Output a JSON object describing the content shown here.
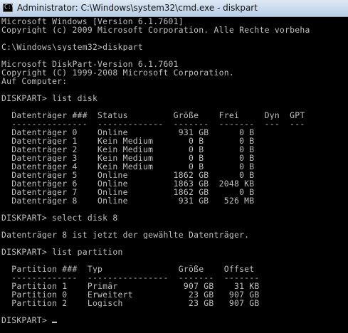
{
  "window": {
    "title": "Administrator: C:\\Windows\\system32\\cmd.exe - diskpart",
    "icon": "console-icon",
    "icon_glyph": "C:\\"
  },
  "console": {
    "lines": [
      "Microsoft Windows [Version 6.1.7601]",
      "Copyright (c) 2009 Microsoft Corporation. Alle Rechte vorbeha",
      "",
      "C:\\Windows\\system32>diskpart",
      "",
      "Microsoft DiskPart-Version 6.1.7601",
      "Copyright (C) 1999-2008 Microsoft Corporation.",
      "Auf Computer:",
      "",
      "DISKPART> list disk",
      "",
      "  Datenträger ###  Status         Größe    Frei     Dyn  GPT",
      "  ---------------  -------------  -------  -------  ---  ---",
      "  Datenträger 0    Online          931 GB      0 B",
      "  Datenträger 1    Kein Medium       0 B       0 B",
      "  Datenträger 2    Kein Medium       0 B       0 B",
      "  Datenträger 3    Kein Medium       0 B       0 B",
      "  Datenträger 4    Kein Medium       0 B       0 B",
      "  Datenträger 5    Online         1862 GB      0 B",
      "  Datenträger 6    Online         1863 GB  2048 KB",
      "  Datenträger 7    Online         1862 GB      0 B",
      "  Datenträger 8    Online          931 GB   526 MB",
      "",
      "DISKPART> select disk 8",
      "",
      "Datenträger 8 ist jetzt der gewählte Datenträger.",
      "",
      "DISKPART> list partition",
      "",
      "  Partition ###  Typ               Größe    Offset",
      "  -------------  ----------------  -------  -------",
      "  Partition 1    Primär             907 GB    31 KB",
      "  Partition 0    Erweitert           23 GB   907 GB",
      "  Partition 2    Logisch             23 GB   907 GB",
      "",
      "DISKPART> "
    ]
  }
}
